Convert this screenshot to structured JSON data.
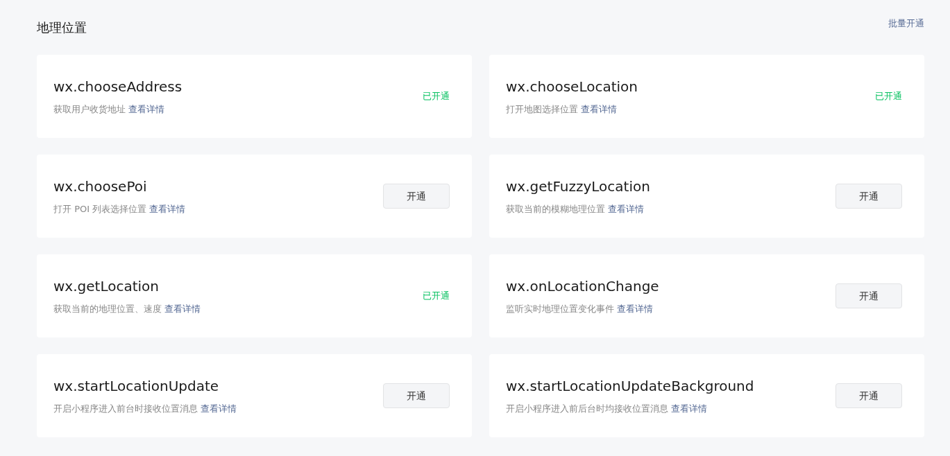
{
  "header": {
    "title": "地理位置",
    "bulk_action": "批量开通"
  },
  "apis": [
    {
      "name": "wx.chooseAddress",
      "description": "获取用户收货地址",
      "link": "查看详情",
      "kind": "status",
      "action": "已开通"
    },
    {
      "name": "wx.chooseLocation",
      "description": "打开地图选择位置",
      "link": "查看详情",
      "kind": "status",
      "action": "已开通"
    },
    {
      "name": "wx.choosePoi",
      "description": "打开 POI 列表选择位置",
      "link": "查看详情",
      "kind": "button",
      "action": "开通"
    },
    {
      "name": "wx.getFuzzyLocation",
      "description": "获取当前的模糊地理位置",
      "link": "查看详情",
      "kind": "button",
      "action": "开通"
    },
    {
      "name": "wx.getLocation",
      "description": "获取当前的地理位置、速度",
      "link": "查看详情",
      "kind": "status",
      "action": "已开通"
    },
    {
      "name": "wx.onLocationChange",
      "description": "监听实时地理位置变化事件",
      "link": "查看详情",
      "kind": "button",
      "action": "开通"
    },
    {
      "name": "wx.startLocationUpdate",
      "description": "开启小程序进入前台时接收位置消息",
      "link": "查看详情",
      "kind": "button",
      "action": "开通"
    },
    {
      "name": "wx.startLocationUpdateBackground",
      "description": "开启小程序进入前后台时均接收位置消息",
      "link": "查看详情",
      "kind": "button",
      "action": "开通"
    }
  ]
}
